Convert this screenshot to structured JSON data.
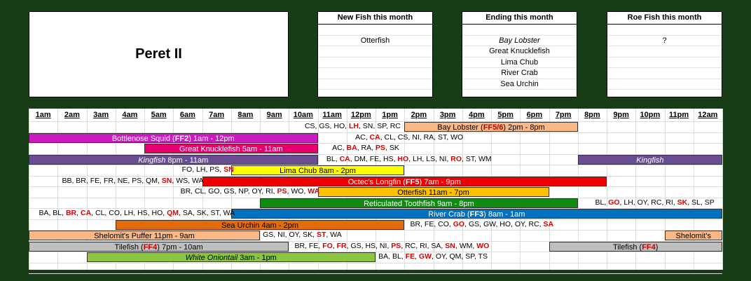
{
  "title": "Peret II",
  "panels": {
    "new": {
      "header": "New Fish this month",
      "items": [
        "",
        "Otterfish",
        "",
        "",
        "",
        "",
        ""
      ]
    },
    "ending": {
      "header": "Ending this month",
      "items": [
        "",
        "Bay Lobster",
        "Great Knucklefish",
        "Lima Chub",
        "River Crab",
        "Sea Urchin",
        ""
      ]
    },
    "roe": {
      "header": "Roe Fish this month",
      "items": [
        "",
        "?",
        "",
        "",
        "",
        "",
        ""
      ]
    }
  },
  "hours": [
    "1am",
    "2am",
    "3am",
    "4am",
    "5am",
    "6am",
    "7am",
    "8am",
    "9am",
    "10am",
    "11am",
    "12pm",
    "1pm",
    "2pm",
    "3pm",
    "4pm",
    "5pm",
    "6pm",
    "7pm",
    "8pm",
    "9pm",
    "10pm",
    "11pm",
    "12am"
  ],
  "bars": [
    {
      "row": 1,
      "start": 13,
      "end": 19,
      "color": "#f9b886",
      "tc": "#000",
      "segs": [
        {
          "t": "Bay Lobster ("
        },
        {
          "t": "FF5/6",
          "c": "#c00000",
          "b": true
        },
        {
          "t": ")  2pm - 8pm"
        }
      ]
    },
    {
      "row": 2,
      "start": 0,
      "end": 10,
      "color": "#cc19c2",
      "tc": "#fff",
      "segs": [
        {
          "t": "Bottlenose Squid ("
        },
        {
          "t": "FF2",
          "b": true
        },
        {
          "t": ")  1am - 12pm"
        }
      ]
    },
    {
      "row": 3,
      "start": 4,
      "end": 10,
      "color": "#e8006e",
      "tc": "#fff",
      "segs": [
        {
          "t": "Great Knucklefish  5am - 11am"
        }
      ]
    },
    {
      "row": 4,
      "start": 0,
      "end": 10,
      "color": "#6a4c93",
      "tc": "#fff",
      "segs": [
        {
          "t": "Kingfish",
          "i": true
        },
        {
          "t": "  8pm - 11am"
        }
      ]
    },
    {
      "row": 4,
      "start": 19,
      "end": 24,
      "color": "#6a4c93",
      "tc": "#fff",
      "segs": [
        {
          "t": "Kingfish",
          "i": true
        }
      ]
    },
    {
      "row": 5,
      "start": 7,
      "end": 13,
      "color": "#ffff00",
      "tc": "#000",
      "segs": [
        {
          "t": "Lima Chub  8am - 2pm"
        }
      ]
    },
    {
      "row": 6,
      "start": 6,
      "end": 20,
      "color": "#ee0000",
      "tc": "#fff",
      "segs": [
        {
          "t": "Octec's Longfin ("
        },
        {
          "t": "FF5",
          "b": true
        },
        {
          "t": ")  7am - 9pm"
        }
      ]
    },
    {
      "row": 7,
      "start": 10,
      "end": 18,
      "color": "#ffc000",
      "tc": "#000",
      "segs": [
        {
          "t": "Otterfish  11am - 7pm"
        }
      ]
    },
    {
      "row": 8,
      "start": 8,
      "end": 19,
      "color": "#108a10",
      "tc": "#fff",
      "segs": [
        {
          "t": "Reticulated Toothfish  9am - 8pm"
        }
      ]
    },
    {
      "row": 9,
      "start": 7,
      "end": 24,
      "color": "#0070c0",
      "tc": "#fff",
      "segs": [
        {
          "t": "River Crab ("
        },
        {
          "t": "FF3",
          "b": true
        },
        {
          "t": ")  8am - 1am"
        }
      ]
    },
    {
      "row": 10,
      "start": 3,
      "end": 13,
      "color": "#e36c0a",
      "tc": "#000",
      "segs": [
        {
          "t": "Sea Urchin  4am - 2pm"
        }
      ]
    },
    {
      "row": 11,
      "start": 0,
      "end": 8,
      "color": "#f9b886",
      "tc": "#000",
      "segs": [
        {
          "t": "Shelomit's Puffer  11pm - 9am"
        }
      ]
    },
    {
      "row": 11,
      "start": 22,
      "end": 24,
      "color": "#f9b886",
      "tc": "#000",
      "segs": [
        {
          "t": "Shelomit's"
        }
      ]
    },
    {
      "row": 12,
      "start": 0,
      "end": 9,
      "color": "#bfbfbf",
      "tc": "#000",
      "segs": [
        {
          "t": "Tilefish ("
        },
        {
          "t": "FF4",
          "c": "#c00000",
          "b": true
        },
        {
          "t": ")  7pm - 10am"
        }
      ]
    },
    {
      "row": 12,
      "start": 18,
      "end": 24,
      "color": "#bfbfbf",
      "tc": "#000",
      "segs": [
        {
          "t": "Tilefish ("
        },
        {
          "t": "FF4",
          "c": "#c00000",
          "b": true
        },
        {
          "t": ")"
        }
      ]
    },
    {
      "row": 13,
      "start": 2,
      "end": 12,
      "color": "#8cc63f",
      "tc": "#000",
      "segs": [
        {
          "t": "White Oniontail",
          "i": true
        },
        {
          "t": "  3am - 1pm"
        }
      ]
    }
  ],
  "locations": [
    {
      "row": 1,
      "start": 9.55,
      "segs": [
        {
          "t": "CS, GS, HO, "
        },
        {
          "t": "LH",
          "r": true
        },
        {
          "t": ", SN, SP, RC"
        }
      ]
    },
    {
      "row": 2,
      "start": 11.3,
      "segs": [
        {
          "t": "AC, "
        },
        {
          "t": "CA",
          "r": true
        },
        {
          "t": ", CL, CS, NI, RA, ST, WO"
        }
      ]
    },
    {
      "row": 3,
      "start": 10.5,
      "segs": [
        {
          "t": "AC, "
        },
        {
          "t": "BA",
          "r": true
        },
        {
          "t": ", RA, "
        },
        {
          "t": "PS",
          "r": true
        },
        {
          "t": ", SK"
        }
      ]
    },
    {
      "row": 4,
      "start": 10.3,
      "segs": [
        {
          "t": "BL, "
        },
        {
          "t": "CA",
          "r": true
        },
        {
          "t": ", DM, FE, HS, "
        },
        {
          "t": "HO",
          "r": true
        },
        {
          "t": ", LH, LS, NI, "
        },
        {
          "t": "RO",
          "r": true
        },
        {
          "t": ", ST, WM"
        }
      ]
    },
    {
      "row": 5,
      "start": 5.3,
      "segs": [
        {
          "t": "FO, LH, PS, "
        },
        {
          "t": "SN",
          "r": true
        }
      ]
    },
    {
      "row": 6,
      "start": 1.15,
      "segs": [
        {
          "t": "BB, BR, FE, FR, NE, PS, QM, "
        },
        {
          "t": "SN",
          "r": true
        },
        {
          "t": ", WS, WA"
        }
      ]
    },
    {
      "row": 7,
      "start": 5.25,
      "segs": [
        {
          "t": "BR, CL, GO, GS, NP, OY, RI, "
        },
        {
          "t": "PS",
          "r": true
        },
        {
          "t": ", WO, "
        },
        {
          "t": "WA",
          "r": true
        }
      ]
    },
    {
      "row": 8,
      "start": 19.6,
      "segs": [
        {
          "t": "BL, "
        },
        {
          "t": "GO",
          "r": true
        },
        {
          "t": ", LH, OY, RC, RI, "
        },
        {
          "t": "SK",
          "r": true
        },
        {
          "t": ", SL, SP"
        }
      ]
    },
    {
      "row": 9,
      "start": 0.35,
      "segs": [
        {
          "t": "BA, BL, "
        },
        {
          "t": "BR",
          "r": true
        },
        {
          "t": ", "
        },
        {
          "t": "CA",
          "r": true
        },
        {
          "t": ", CL, CO, LH, HS, HO, "
        },
        {
          "t": "QM",
          "r": true
        },
        {
          "t": ", SA, SK, ST, WA"
        }
      ]
    },
    {
      "row": 10,
      "start": 13.2,
      "segs": [
        {
          "t": "BR, FE, CO, "
        },
        {
          "t": "GO",
          "r": true
        },
        {
          "t": ", GS, GW, HO, OY, RC, "
        },
        {
          "t": "SA",
          "r": true
        }
      ]
    },
    {
      "row": 11,
      "start": 8.1,
      "segs": [
        {
          "t": "GS, NI, OY, SK, "
        },
        {
          "t": "ST",
          "r": true
        },
        {
          "t": ", WA"
        }
      ]
    },
    {
      "row": 12,
      "start": 9.2,
      "segs": [
        {
          "t": "BR, FE, "
        },
        {
          "t": "FO",
          "r": true
        },
        {
          "t": ", "
        },
        {
          "t": "FR",
          "r": true
        },
        {
          "t": ", GS, HS, NI, "
        },
        {
          "t": "PS",
          "r": true
        },
        {
          "t": ", RC, RI, SA, "
        },
        {
          "t": "SN",
          "r": true
        },
        {
          "t": ", WM, "
        },
        {
          "t": "WO",
          "r": true
        }
      ]
    },
    {
      "row": 13,
      "start": 12.1,
      "segs": [
        {
          "t": "BA, BL, "
        },
        {
          "t": "FE",
          "r": true
        },
        {
          "t": ", "
        },
        {
          "t": "GW",
          "r": true
        },
        {
          "t": ", OY, QM, SP, TS"
        }
      ]
    }
  ]
}
